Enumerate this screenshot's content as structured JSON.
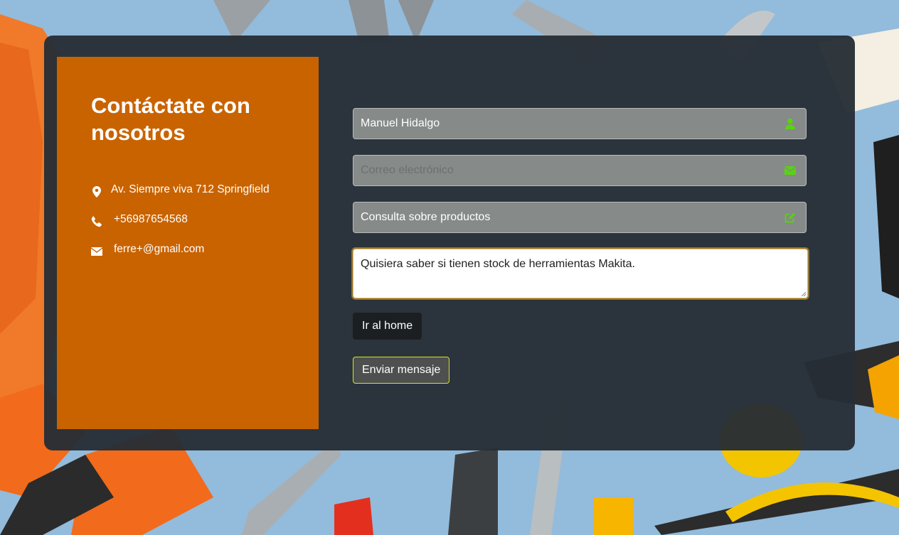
{
  "contact": {
    "title": "Contáctate con nosotros",
    "address": "Av. Siempre viva 712 Springfield",
    "phone": "+56987654568",
    "email": "ferre+@gmail.com"
  },
  "form": {
    "name_value": "Manuel Hidalgo",
    "email_placeholder": "Correo electrónico",
    "email_value": "",
    "subject_value": "Consulta sobre productos",
    "message_value": "Quisiera saber si tienen stock de herramientas Makita.",
    "home_button_label": "Ir al home",
    "send_button_label": "Enviar mensaje"
  },
  "icons": {
    "address": "map-marker-icon",
    "phone": "phone-icon",
    "email": "envelope-icon",
    "name_field": "user-icon",
    "email_field": "envelope-icon",
    "subject_field": "edit-icon"
  },
  "colors": {
    "panel": "#c96300",
    "card": "#262e35",
    "field_bg": "#868a89",
    "field_icon": "#58d40e",
    "send_border": "#d4e61c",
    "page_bg": "#93bbdb"
  }
}
